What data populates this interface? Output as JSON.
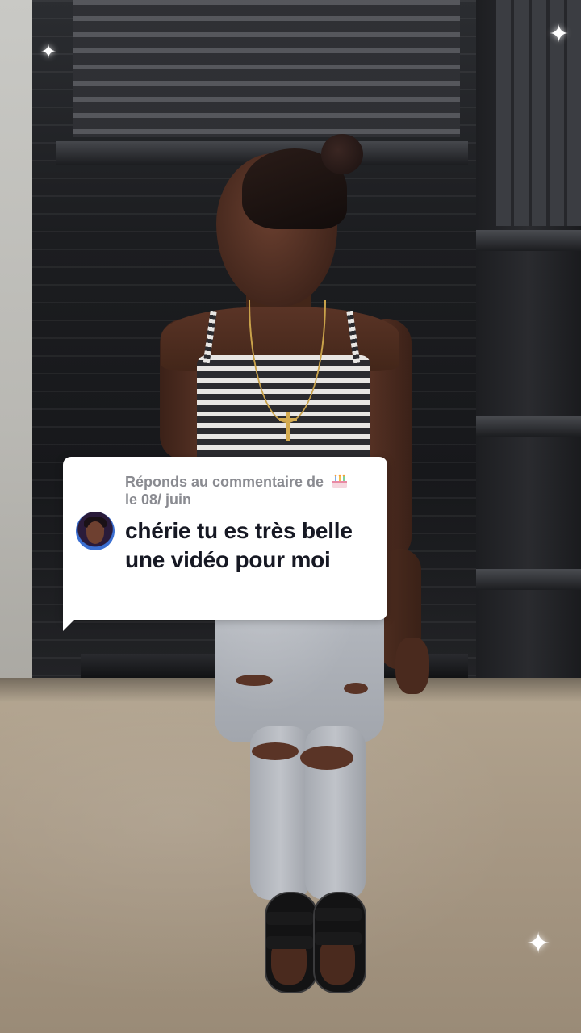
{
  "reply_sticker": {
    "header_prefix": "Réponds au commentaire de",
    "header_emoji": "birthday-cake-emoji",
    "header_date": "le 08/ juin",
    "comment": "chérie tu es très belle une vidéo pour moi",
    "avatar_icon": "commenter-avatar"
  },
  "decor": {
    "sparkle_glyph": "✦"
  },
  "colors": {
    "sticker_bg": "#ffffff",
    "header_text": "#8a8b91",
    "comment_text": "#161823"
  }
}
